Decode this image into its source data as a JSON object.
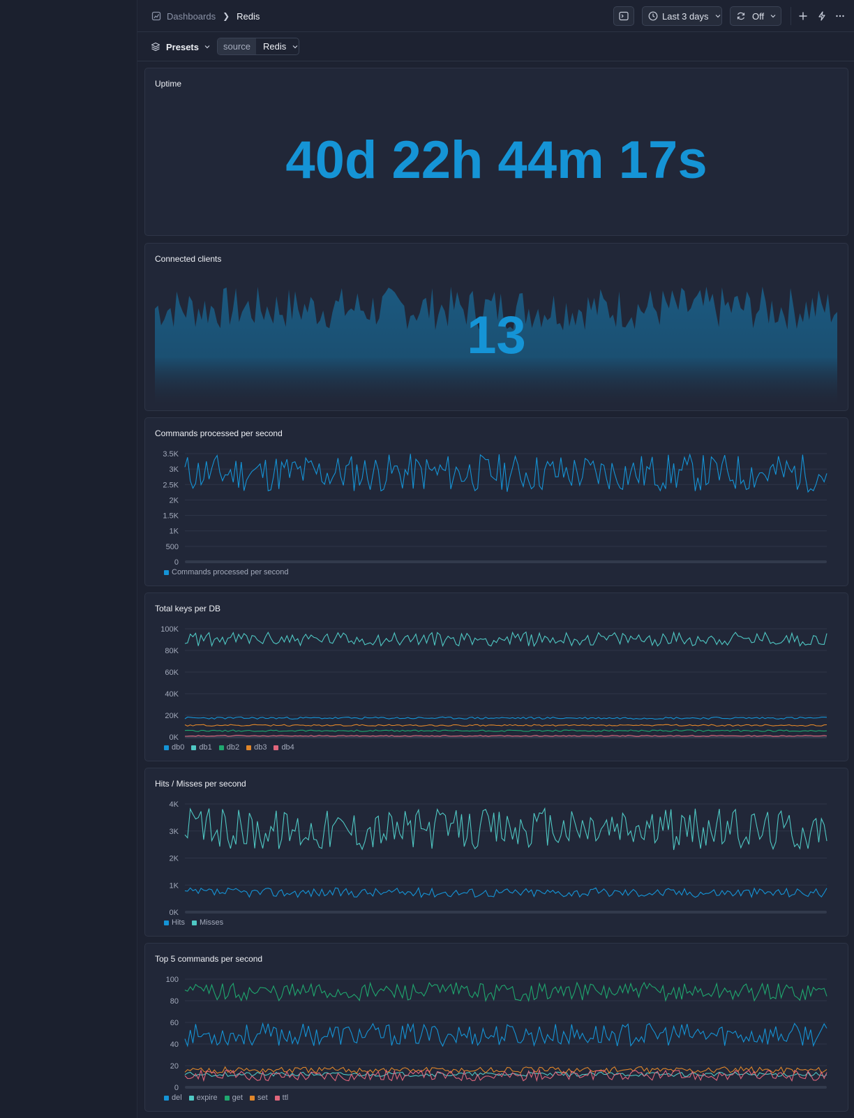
{
  "breadcrumbs": {
    "parent": "Dashboards",
    "current": "Redis"
  },
  "toolbar": {
    "time_range": "Last 3 days",
    "refresh": "Off"
  },
  "filters": {
    "presets_label": "Presets",
    "source_key": "source",
    "source_value": "Redis"
  },
  "colors": {
    "blue": "#1594d6",
    "teal": "#4fc8c4",
    "green": "#1fa86f",
    "orange": "#e0862a",
    "pink": "#e0667c"
  },
  "panels": {
    "uptime": {
      "title": "Uptime",
      "value": "40d 22h 44m 17s"
    },
    "clients": {
      "title": "Connected clients",
      "value": "13"
    },
    "commands": {
      "title": "Commands processed per second"
    },
    "keys": {
      "title": "Total keys per DB"
    },
    "hits": {
      "title": "Hits / Misses per second"
    },
    "top5": {
      "title": "Top 5 commands per second"
    }
  },
  "chart_data": [
    {
      "type": "area",
      "id": "clients",
      "title": "Connected clients",
      "ylim": [
        0,
        18
      ],
      "series": [
        {
          "values_range": [
            10,
            16
          ]
        }
      ]
    },
    {
      "type": "line",
      "id": "commands",
      "title": "Commands processed per second",
      "yticks": [
        "0",
        "500",
        "1K",
        "1.5K",
        "2K",
        "2.5K",
        "3K",
        "3.5K"
      ],
      "ylim": [
        0,
        3500
      ],
      "series": [
        {
          "name": "Commands processed per second",
          "color": "#1594d6",
          "range": [
            2250,
            3500
          ]
        }
      ],
      "legend": [
        "Commands processed per second"
      ]
    },
    {
      "type": "line",
      "id": "keys",
      "title": "Total keys per DB",
      "yticks": [
        "0K",
        "20K",
        "40K",
        "60K",
        "80K",
        "100K"
      ],
      "ylim": [
        0,
        100000
      ],
      "series": [
        {
          "name": "db0",
          "color": "#1594d6",
          "range": [
            16500,
            18500
          ]
        },
        {
          "name": "db1",
          "color": "#4fc8c4",
          "range": [
            84000,
            97000
          ]
        },
        {
          "name": "db2",
          "color": "#1fa86f",
          "range": [
            5000,
            6500
          ]
        },
        {
          "name": "db3",
          "color": "#e0862a",
          "range": [
            10000,
            11500
          ]
        },
        {
          "name": "db4",
          "color": "#e0667c",
          "range": [
            500,
            1500
          ]
        }
      ],
      "legend": [
        "db0",
        "db1",
        "db2",
        "db3",
        "db4"
      ]
    },
    {
      "type": "line",
      "id": "hits",
      "title": "Hits / Misses per second",
      "yticks": [
        "0K",
        "1K",
        "2K",
        "3K",
        "4K"
      ],
      "ylim": [
        0,
        4000
      ],
      "series": [
        {
          "name": "Hits",
          "color": "#1594d6",
          "range": [
            550,
            900
          ]
        },
        {
          "name": "Misses",
          "color": "#4fc8c4",
          "range": [
            2300,
            3850
          ]
        }
      ],
      "legend": [
        "Hits",
        "Misses"
      ]
    },
    {
      "type": "line",
      "id": "top5",
      "title": "Top 5 commands per second",
      "yticks": [
        "0",
        "20",
        "40",
        "60",
        "80",
        "100"
      ],
      "ylim": [
        0,
        100
      ],
      "series": [
        {
          "name": "del",
          "color": "#1594d6",
          "range": [
            38,
            59
          ]
        },
        {
          "name": "expire",
          "color": "#4fc8c4",
          "range": [
            10,
            14
          ]
        },
        {
          "name": "get",
          "color": "#1fa86f",
          "range": [
            80,
            97
          ]
        },
        {
          "name": "set",
          "color": "#e0862a",
          "range": [
            13,
            19
          ]
        },
        {
          "name": "ttl",
          "color": "#e0667c",
          "range": [
            6,
            16
          ]
        }
      ],
      "legend": [
        "del",
        "expire",
        "get",
        "set",
        "ttl"
      ]
    }
  ]
}
